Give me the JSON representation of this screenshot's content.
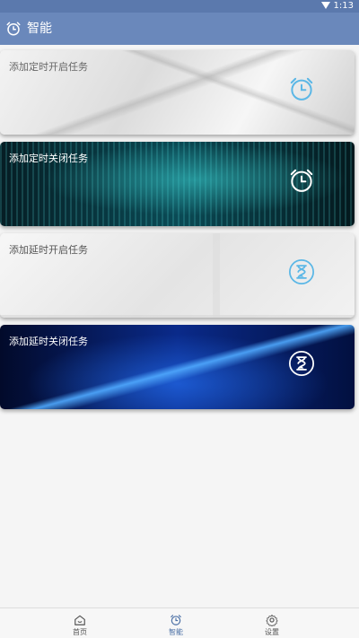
{
  "status_bar": {
    "time": "1:13"
  },
  "app_bar": {
    "title": "智能"
  },
  "cards": [
    {
      "label": "添加定时开启任务",
      "icon": "alarm-clock-icon",
      "icon_color": "#5bb7e6"
    },
    {
      "label": "添加定时关闭任务",
      "icon": "alarm-clock-icon",
      "icon_color": "#ffffff"
    },
    {
      "label": "添加延时开启任务",
      "icon": "hourglass-icon",
      "icon_color": "#5bb7e6"
    },
    {
      "label": "添加延时关闭任务",
      "icon": "hourglass-icon",
      "icon_color": "#ffffff"
    }
  ],
  "bottom_nav": {
    "items": [
      {
        "label": "首页",
        "icon": "home-icon",
        "active": false
      },
      {
        "label": "智能",
        "icon": "alarm-clock-icon",
        "active": true
      },
      {
        "label": "设置",
        "icon": "gear-icon",
        "active": false
      }
    ]
  },
  "colors": {
    "app_bar": "#6a88bb",
    "active_tab": "#4a6fa5"
  }
}
